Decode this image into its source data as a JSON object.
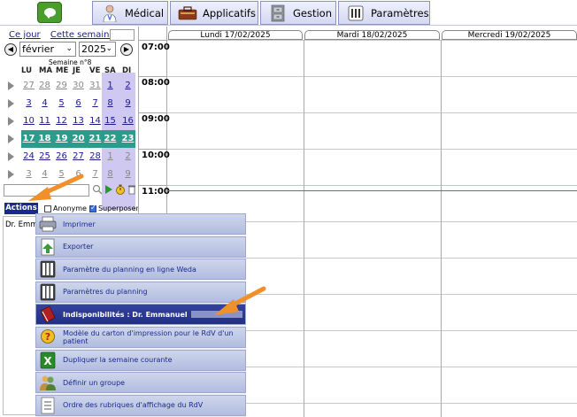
{
  "topbar": {
    "tabs": [
      {
        "label": "Médical",
        "icon": "doctor-icon"
      },
      {
        "label": "Applicatifs",
        "icon": "toolbox-icon"
      },
      {
        "label": "Gestion",
        "icon": "cabinet-icon"
      },
      {
        "label": "Paramètres",
        "icon": "settings-icon"
      }
    ]
  },
  "sidebar": {
    "today_link": "Ce jour",
    "week_link": "Cette semaine",
    "month_select": "février",
    "year_select": "2025",
    "week_number": "Semaine n°8",
    "weekdays": [
      "LU",
      "MA",
      "ME",
      "JE",
      "VE",
      "SA",
      "DI"
    ],
    "weeks": [
      [
        "27",
        "28",
        "29",
        "30",
        "31",
        "1",
        "2"
      ],
      [
        "3",
        "4",
        "5",
        "6",
        "7",
        "8",
        "9"
      ],
      [
        "10",
        "11",
        "12",
        "13",
        "14",
        "15",
        "16"
      ],
      [
        "17",
        "18",
        "19",
        "20",
        "21",
        "22",
        "23"
      ],
      [
        "24",
        "25",
        "26",
        "27",
        "28",
        "1",
        "2"
      ],
      [
        "3",
        "4",
        "5",
        "6",
        "7",
        "8",
        "9"
      ]
    ],
    "actions_label": "Actions",
    "anonyme_label": "Anonyme",
    "superposer_label": "Superposer",
    "doctor_name": "Dr. Emma"
  },
  "calendar": {
    "days": [
      "Lundi 17/02/2025",
      "Mardi 18/02/2025",
      "Mercredi 19/02/2025"
    ],
    "hours": [
      "07:00",
      "08:00",
      "09:00",
      "10:00",
      "11:00"
    ]
  },
  "menu": {
    "items": [
      {
        "label": "Imprimer",
        "icon": "printer-icon"
      },
      {
        "label": "Exporter",
        "icon": "export-icon"
      },
      {
        "label": "Paramètre du planning en ligne Weda",
        "icon": "planning-icon"
      },
      {
        "label": "Paramètres du planning",
        "icon": "planning-icon"
      },
      {
        "label": "Indisponibilités : Dr. Emmanuel",
        "icon": "book-icon",
        "active": true
      },
      {
        "label": "Modèle du carton d'impression pour le RdV d'un patient",
        "icon": "question-icon"
      },
      {
        "label": "Dupliquer la semaine courante",
        "icon": "excel-icon"
      },
      {
        "label": "Définir un groupe",
        "icon": "group-icon"
      },
      {
        "label": "Ordre des rubriques d'affichage du RdV",
        "icon": "list-icon"
      }
    ]
  },
  "colors": {
    "accent": "#1a2a8c",
    "current_week": "#2b9b8b",
    "weekend": "#cfc8f0",
    "arrow": "#f0902a",
    "now_line": "#e04040"
  }
}
